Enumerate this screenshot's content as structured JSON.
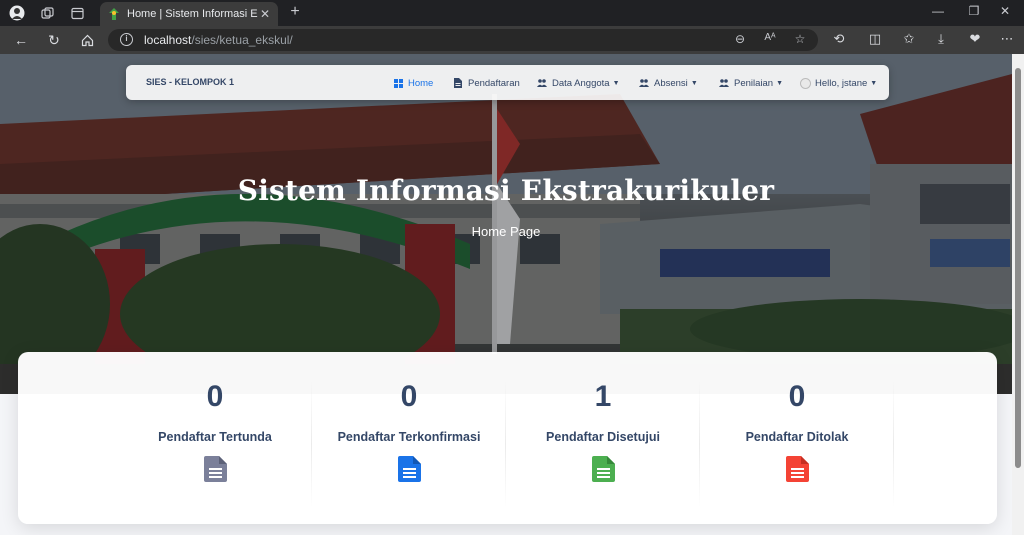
{
  "browser": {
    "tab_title": "Home | Sistem Informasi Ekstrakur",
    "url_host": "localhost",
    "url_path": "/sies/ketua_ekskul/"
  },
  "navbar": {
    "brand": "SIES - KELOMPOK 1",
    "items": [
      {
        "label": "Home",
        "icon": "dashboard-icon",
        "active": true
      },
      {
        "label": "Pendaftaran",
        "icon": "document-icon"
      },
      {
        "label": "Data Anggota",
        "icon": "users-icon",
        "dropdown": true
      },
      {
        "label": "Absensi",
        "icon": "users-icon",
        "dropdown": true
      },
      {
        "label": "Penilaian",
        "icon": "users-icon",
        "dropdown": true
      },
      {
        "label": "Hello, jstane",
        "icon": "avatar",
        "dropdown": true
      }
    ]
  },
  "hero": {
    "title": "Sistem Informasi Ekstrakurikuler",
    "subtitle": "Home Page"
  },
  "stats": [
    {
      "value": "0",
      "label": "Pendaftar Tertunda",
      "icon": "document-icon",
      "color": "#7b809a"
    },
    {
      "value": "0",
      "label": "Pendaftar Terkonfirmasi",
      "icon": "document-icon",
      "color": "#1a73e8"
    },
    {
      "value": "1",
      "label": "Pendaftar Disetujui",
      "icon": "document-icon",
      "color": "#4caf50"
    },
    {
      "value": "0",
      "label": "Pendaftar Ditolak",
      "icon": "document-icon",
      "color": "#f44335"
    }
  ],
  "colors": {
    "primary_text": "#344767",
    "accent": "#1a73e8"
  }
}
